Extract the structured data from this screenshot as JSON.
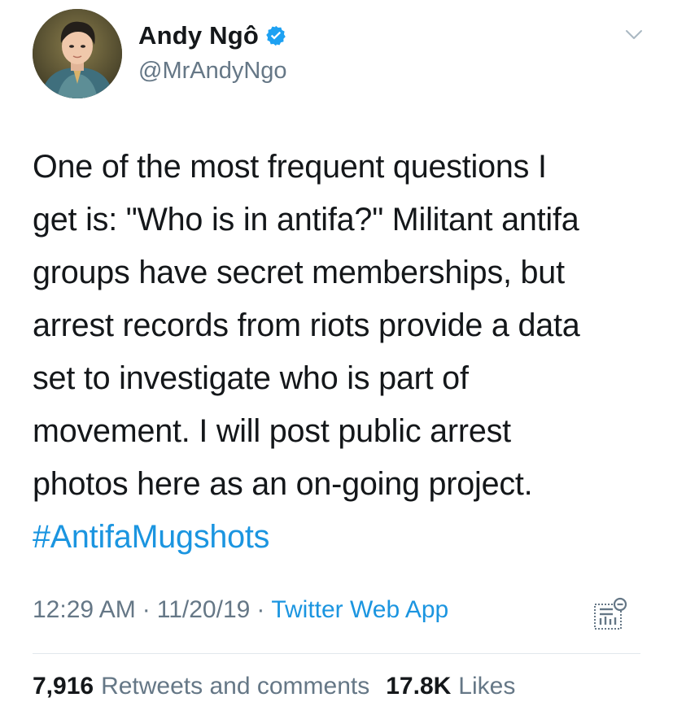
{
  "author": {
    "display_name": "Andy Ngô",
    "handle": "@MrAndyNgo",
    "verified": true
  },
  "tweet": {
    "text_lines": [
      "One of the most frequent questions I",
      "get is: \"Who is in antifa?\" Militant antifa",
      "groups have secret memberships, but",
      "arrest records from riots provide a data",
      "set to investigate who is part of",
      "movement. I will post public arrest",
      "photos here as an on-going project."
    ],
    "hashtag": "#AntifaMugshots"
  },
  "meta": {
    "time": "12:29 AM",
    "separator": "·",
    "date": "11/20/19",
    "source": "Twitter Web App"
  },
  "stats": {
    "retweets_count": "7,916",
    "retweets_label": "Retweets and comments",
    "likes_count": "17.8K",
    "likes_label": "Likes"
  },
  "icons": {
    "verified": "verified-badge-icon",
    "caret": "chevron-down-icon",
    "analytics": "tweet-analytics-icon"
  },
  "colors": {
    "link": "#1b95e0",
    "secondary_text": "#657786",
    "primary_text": "#14171a",
    "verified": "#1da1f2",
    "divider": "#e1e8ed"
  }
}
